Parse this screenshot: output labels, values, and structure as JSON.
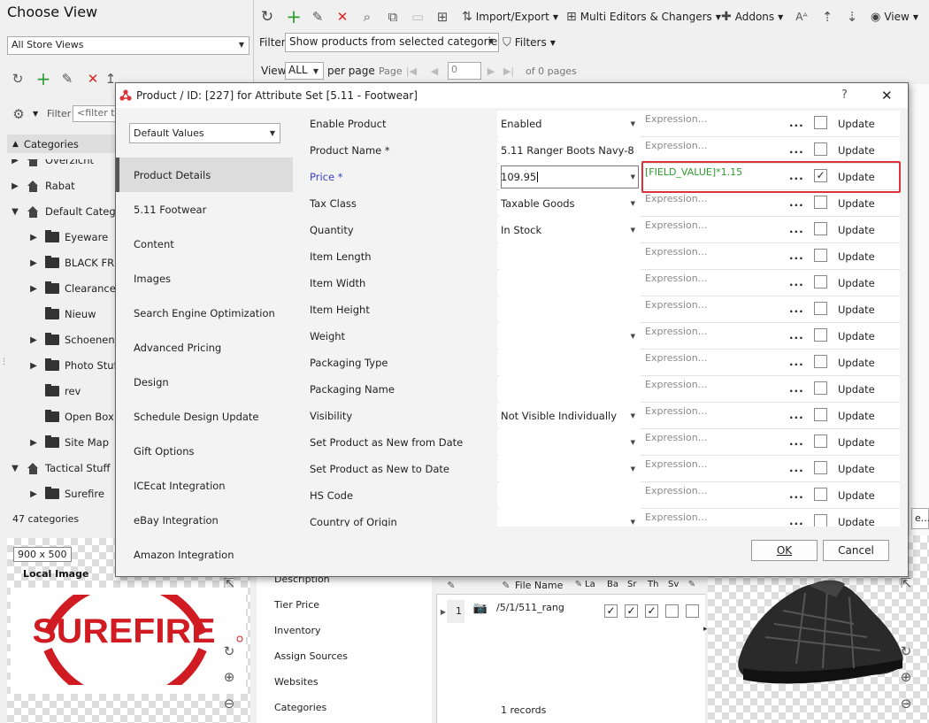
{
  "left_panel": {
    "title": "Choose View",
    "store_view": "All Store Views",
    "filter_label": "Filter",
    "filter_placeholder": "<filter te",
    "categories_header": "Categories",
    "tree": [
      {
        "label": "Overzicht",
        "level": 0,
        "type": "store",
        "toggle": "▶"
      },
      {
        "label": "Rabat",
        "level": 0,
        "type": "store",
        "toggle": "▶"
      },
      {
        "label": "Default Catego",
        "level": 0,
        "type": "store",
        "toggle": "▼"
      },
      {
        "label": "Eyeware",
        "level": 1,
        "type": "folder",
        "toggle": "▶"
      },
      {
        "label": "BLACK FRID",
        "level": 1,
        "type": "folder",
        "toggle": "▶"
      },
      {
        "label": "Clearance S",
        "level": 1,
        "type": "folder",
        "toggle": "▶"
      },
      {
        "label": "Nieuw",
        "level": 1,
        "type": "folder",
        "toggle": ""
      },
      {
        "label": "Schoenen",
        "level": 1,
        "type": "folder",
        "toggle": "▶"
      },
      {
        "label": "Photo Stuff",
        "level": 1,
        "type": "folder",
        "toggle": "▶"
      },
      {
        "label": "rev",
        "level": 1,
        "type": "folder",
        "toggle": ""
      },
      {
        "label": "Open Box S",
        "level": 1,
        "type": "folder",
        "toggle": ""
      },
      {
        "label": "Site Map",
        "level": 1,
        "type": "folder",
        "toggle": "▶"
      },
      {
        "label": "Tactical Stuff",
        "level": 0,
        "type": "store",
        "toggle": "▼"
      },
      {
        "label": "Surefire",
        "level": 1,
        "type": "folder",
        "toggle": "▶"
      }
    ],
    "count": "47 categories",
    "image_size": "900 x 500",
    "local_image": "Local Image",
    "logo_text": "SUREFIRE"
  },
  "toolbar": {
    "import_export": "Import/Export",
    "multi_editors": "Multi Editors & Changers",
    "addons": "Addons",
    "view": "View",
    "filter_label": "Filter",
    "filter_value": "Show products from selected categories",
    "filters": "Filters",
    "view_label": "View",
    "view_count": "ALL",
    "per_page": "per page",
    "page_label": "Page",
    "page_value": "0",
    "of_pages": "of 0 pages"
  },
  "dialog": {
    "title": "Product / ID: [227] for Attribute Set [5.11 - Footwear]",
    "help": "?",
    "close": "✕",
    "view_select": "Default Values",
    "nav": [
      "Product Details",
      "5.11 Footwear",
      "Content",
      "Images",
      "Search Engine Optimization",
      "Advanced Pricing",
      "Design",
      "Schedule Design Update",
      "Gift Options",
      "ICEcat Integration",
      "eBay Integration",
      "Amazon Integration"
    ],
    "selected_nav": 0,
    "expression_placeholder": "Expression...",
    "dots": "...",
    "update_label": "Update",
    "rows": [
      {
        "label": "Enable Product",
        "value": "Enabled",
        "dropdown": true,
        "expression": "",
        "checked": false
      },
      {
        "label": "Product Name *",
        "value": "5.11 Ranger Boots Navy-8",
        "dropdown": false,
        "expression": "",
        "checked": false
      },
      {
        "label": "Price *",
        "value": "109.95",
        "dropdown": true,
        "expression": "[FIELD_VALUE]*1.15",
        "checked": true,
        "highlight": true
      },
      {
        "label": "Tax Class",
        "value": "Taxable Goods",
        "dropdown": true,
        "expression": "",
        "checked": false
      },
      {
        "label": "Quantity",
        "value": "In Stock",
        "dropdown": true,
        "expression": "",
        "checked": false
      },
      {
        "label": "Item Length",
        "value": "",
        "dropdown": false,
        "expression": "",
        "checked": false
      },
      {
        "label": "Item Width",
        "value": "",
        "dropdown": false,
        "expression": "",
        "checked": false
      },
      {
        "label": "Item Height",
        "value": "",
        "dropdown": false,
        "expression": "",
        "checked": false
      },
      {
        "label": "Weight",
        "value": "",
        "dropdown": true,
        "expression": "",
        "checked": false
      },
      {
        "label": "Packaging Type",
        "value": "",
        "dropdown": false,
        "expression": "",
        "checked": false
      },
      {
        "label": "Packaging Name",
        "value": "",
        "dropdown": false,
        "expression": "",
        "checked": false
      },
      {
        "label": "Visibility",
        "value": "Not Visible Individually",
        "dropdown": true,
        "expression": "",
        "checked": false
      },
      {
        "label": "Set Product as New from Date",
        "value": "",
        "dropdown": true,
        "expression": "",
        "checked": false
      },
      {
        "label": "Set Product as New to Date",
        "value": "",
        "dropdown": true,
        "expression": "",
        "checked": false
      },
      {
        "label": "HS Code",
        "value": "",
        "dropdown": false,
        "expression": "",
        "checked": false
      },
      {
        "label": "Country of Origin",
        "value": "",
        "dropdown": true,
        "expression": "",
        "checked": false
      }
    ],
    "ok": "OK",
    "cancel": "Cancel"
  },
  "bottom": {
    "menu": [
      "Description",
      "Tier Price",
      "Inventory",
      "Assign Sources",
      "Websites",
      "Categories"
    ],
    "file_header": "File Name",
    "cols": [
      "La",
      "Ba",
      "Sr",
      "Th",
      "Sv"
    ],
    "row_num": "1",
    "row_file": "/5/1/511_rang",
    "row_checks": [
      true,
      true,
      true,
      false,
      false
    ],
    "records": "1 records"
  },
  "colors": {
    "accent_red": "#d9343a",
    "expression_green": "#2d9b2d",
    "price_label": "#3d3dc8",
    "surefire_red": "#d11b22"
  }
}
